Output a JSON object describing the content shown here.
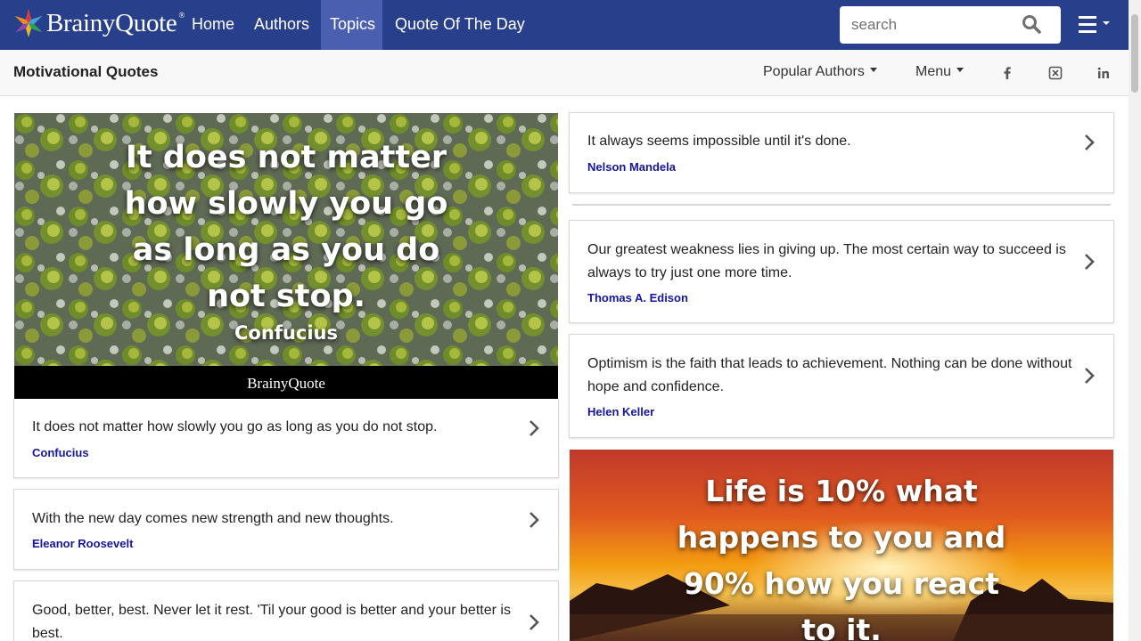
{
  "nav": {
    "logo_text": "BrainyQuote",
    "links": [
      "Home",
      "Authors",
      "Topics",
      "Quote Of The Day"
    ],
    "active": "Topics",
    "search_placeholder": "search"
  },
  "subheader": {
    "title": "Motivational Quotes",
    "popular_authors": "Popular Authors",
    "menu": "Menu",
    "social": [
      "facebook-icon",
      "x-icon",
      "linkedin-icon"
    ]
  },
  "featured": [
    {
      "image_lines": [
        "It does not matter",
        "how slowly you go",
        "as long as you do",
        "not stop."
      ],
      "image_author": "Confucius",
      "image_brand": "BrainyQuote",
      "text": "It does not matter how slowly you go as long as you do not stop.",
      "author": "Confucius"
    },
    {
      "image_lines": [
        "Life is 10% what",
        "happens to you and",
        "90% how you react",
        "to it."
      ]
    }
  ],
  "quotes_left": [
    {
      "text": "With the new day comes new strength and new thoughts.",
      "author": "Eleanor Roosevelt"
    },
    {
      "text": "Good, better, best. Never let it rest. 'Til your good is better and your better is best.",
      "author": ""
    }
  ],
  "quotes_right": [
    {
      "text": "It always seems impossible until it's done.",
      "author": "Nelson Mandela"
    },
    {
      "text": "Our greatest weakness lies in giving up. The most certain way to succeed is always to try just one more time.",
      "author": "Thomas A. Edison"
    },
    {
      "text": "Optimism is the faith that leads to achievement. Nothing can be done without hope and confidence.",
      "author": "Helen Keller"
    }
  ],
  "colors": {
    "nav_bg": "#283f8c",
    "nav_active": "#4a5fb0",
    "author_link": "#1515a3"
  }
}
